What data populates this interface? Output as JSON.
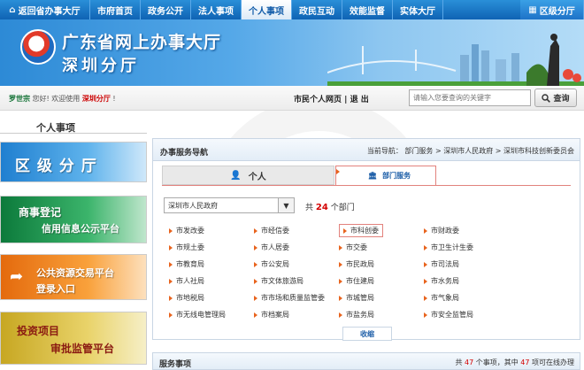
{
  "topnav": {
    "home": "返回省办事大厅",
    "items": [
      "市府首页",
      "政务公开",
      "法人事项",
      "个人事项",
      "政民互动",
      "效能监督",
      "实体大厅"
    ],
    "district": "区级分厅"
  },
  "banner": {
    "title_line1": "广东省网上办事大厅",
    "title_line2": "深圳分厅"
  },
  "userbar": {
    "username": "罗世宗",
    "greeting": "您好! 欢迎使用",
    "branch": "深圳分厅",
    "tail": "!",
    "personal_page": "市民个人网页",
    "separator": "|",
    "logout": "退 出",
    "search_placeholder": "请输入您要查询的关键字",
    "search_button": "查询"
  },
  "left": {
    "title": "个人事项",
    "banners": [
      {
        "line1": "区 级 分 厅",
        "line2": ""
      },
      {
        "line1": "商事登记",
        "line2": "信用信息公示平台"
      },
      {
        "line1": "公共资源交易平台",
        "line2": "登录入口"
      },
      {
        "line1": "投资项目",
        "line2": "审批监管平台"
      }
    ]
  },
  "nav_panel": {
    "title": "办事服务导航",
    "breadcrumb": "当前导航： 部门服务 > 深圳市人民政府 > 深圳市科技创新委员会",
    "tab_person": "个人",
    "tab_dept": "部门服务",
    "select_value": "深圳市人民政府",
    "count_prefix": "共",
    "count": "24",
    "count_suffix": "个部门",
    "departments": [
      "市发改委",
      "市经信委",
      "市科创委",
      "市财政委",
      "市规土委",
      "市人居委",
      "市交委",
      "市卫生计生委",
      "市教育局",
      "市公安局",
      "市民政局",
      "市司法局",
      "市人社局",
      "市文体旅游局",
      "市住建局",
      "市水务局",
      "市地税局",
      "市市场和质量监管委",
      "市城管局",
      "市气象局",
      "市无线电管理局",
      "市档案局",
      "市盐务局",
      "市安全监管局"
    ],
    "collapse": "收缩"
  },
  "services": {
    "title": "服务事项",
    "stat_prefix": "共",
    "total": "47",
    "stat_mid": "个事项，其中",
    "online": "47",
    "stat_suffix": "项可在线办理"
  },
  "colors": {
    "nav_blue": "#0f63b4",
    "accent_red": "#d40000",
    "highlight_border": "#e2827d"
  }
}
